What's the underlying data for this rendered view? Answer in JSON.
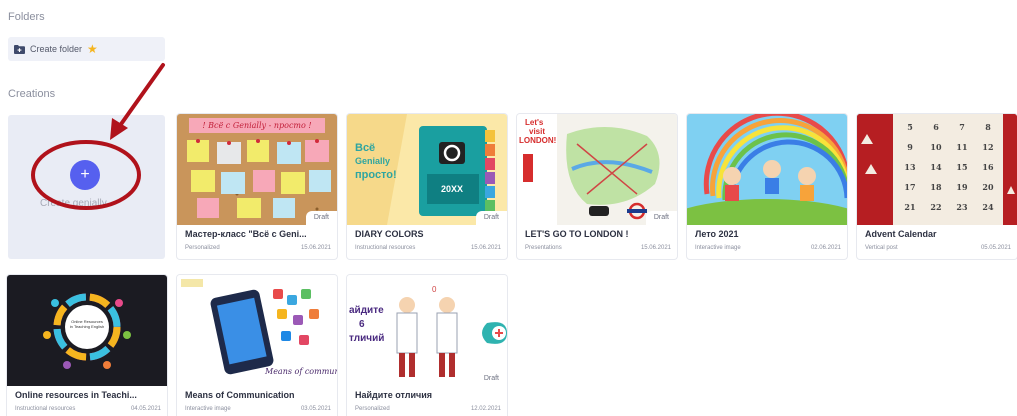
{
  "sections": {
    "folders_label": "Folders",
    "creations_label": "Creations"
  },
  "folders": {
    "create_folder_label": "Create folder",
    "folder_icon": "folder-plus-icon",
    "star_icon": "star-icon",
    "star_color": "#f5b51f"
  },
  "create": {
    "plus_symbol": "+",
    "label": "Create genially",
    "accent_color": "#5660ef"
  },
  "annotation": {
    "color": "#b0121b",
    "shapes": [
      "arrow",
      "ellipse"
    ]
  },
  "cards": [
    {
      "title": "Мастер-класс \"Всё с Geni...",
      "type": "Personalized",
      "date": "15.06.2021",
      "draft": "Draft",
      "thumb_text": [
        "! Всё с Genially - просто !"
      ]
    },
    {
      "title": "DIARY COLORS",
      "type": "Instructional resources",
      "date": "15.06.2021",
      "draft": "Draft",
      "thumb_text": [
        "Всё",
        "Genially",
        "просто!",
        "20XX"
      ]
    },
    {
      "title": "LET'S GO TO LONDON !",
      "type": "Presentations",
      "date": "15.06.2021",
      "draft": "Draft",
      "thumb_text": [
        "Let's",
        "visit",
        "LONDON!"
      ]
    },
    {
      "title": "Лето 2021",
      "type": "Interactive image",
      "date": "02.06.2021",
      "draft": "",
      "thumb_text": []
    },
    {
      "title": "Advent Calendar",
      "type": "Vertical post",
      "date": "05.05.2021",
      "draft": "",
      "thumb_text": [
        "5",
        "6",
        "7",
        "8",
        "9",
        "10",
        "11",
        "12",
        "13",
        "14",
        "15",
        "16",
        "17",
        "18",
        "19",
        "20",
        "21",
        "22",
        "23",
        "24"
      ]
    },
    {
      "title": "Online resources in Teachi...",
      "type": "Instructional resources",
      "date": "04.05.2021",
      "draft": "",
      "thumb_text": [
        "Online Resources in Teaching English"
      ]
    },
    {
      "title": "Means of Communication",
      "type": "Interactive image",
      "date": "03.05.2021",
      "draft": "",
      "thumb_text": [
        "Means of communicati"
      ]
    },
    {
      "title": "Найдите отличия",
      "type": "Personalized",
      "date": "12.02.2021",
      "draft": "Draft",
      "thumb_text": [
        "айдите",
        "6",
        "тличий",
        "0"
      ]
    }
  ]
}
